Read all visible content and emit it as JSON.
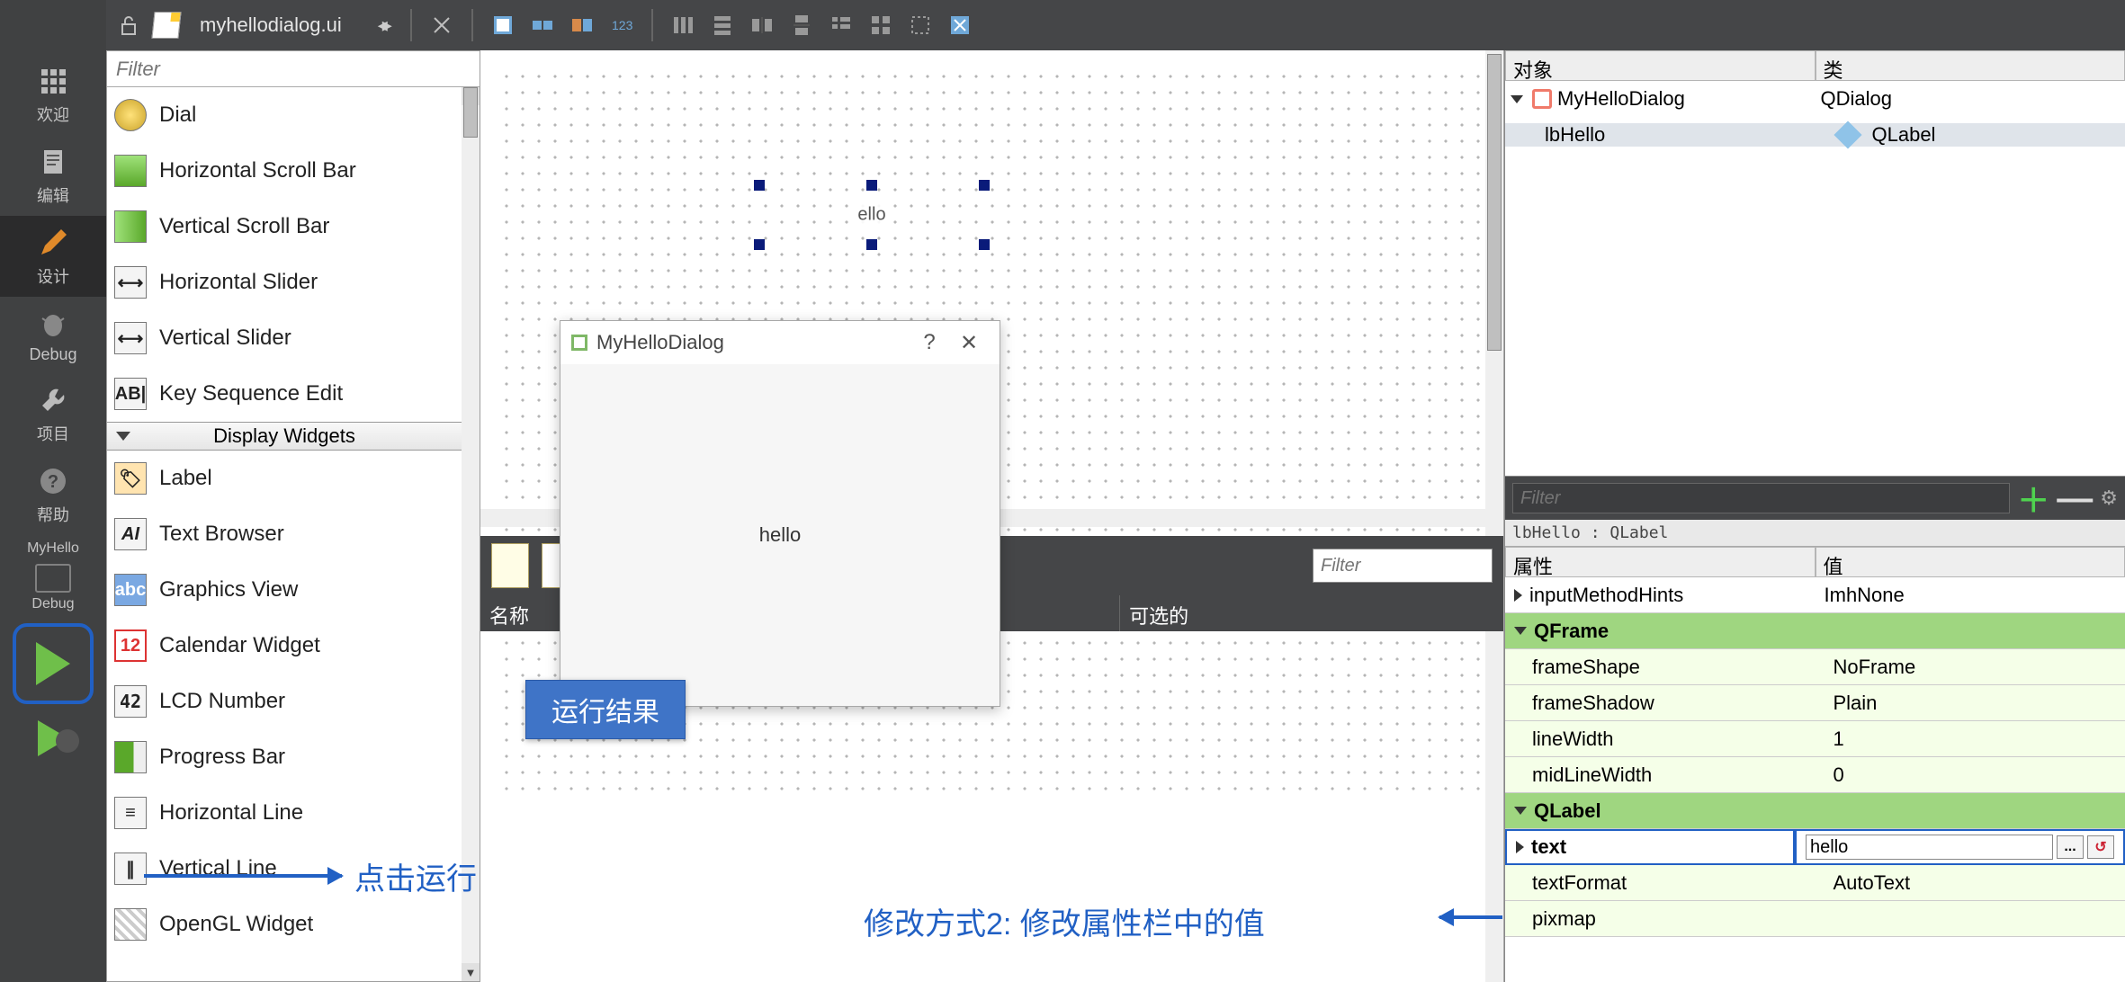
{
  "leftnav": {
    "welcome": "欢迎",
    "edit": "编辑",
    "design": "设计",
    "debug": "Debug",
    "project": "项目",
    "help": "帮助",
    "active_project": "MyHello",
    "kit": "Debug"
  },
  "toolbar": {
    "filename": "myhellodialog.ui"
  },
  "widgetbox": {
    "filter_placeholder": "Filter",
    "group_display": "Display Widgets",
    "items_top": [
      "Dial",
      "Horizontal Scroll Bar",
      "Vertical Scroll Bar",
      "Horizontal Slider",
      "Vertical Slider",
      "Key Sequence Edit"
    ],
    "items_display": [
      "Label",
      "Text Browser",
      "Graphics View",
      "Calendar Widget",
      "LCD Number",
      "Progress Bar",
      "Horizontal Line",
      "Vertical Line",
      "OpenGL Widget"
    ]
  },
  "canvas": {
    "selected_text": "ello"
  },
  "run_dialog": {
    "title": "MyHelloDialog",
    "body": "hello"
  },
  "resources": {
    "filter_placeholder": "Filter",
    "col_name": "名称",
    "col_optional": "可选的"
  },
  "object_tree": {
    "col_object": "对象",
    "col_class": "类",
    "rows": [
      {
        "name": "MyHelloDialog",
        "cls": "QDialog"
      },
      {
        "name": "lbHello",
        "cls": "QLabel"
      }
    ]
  },
  "properties": {
    "filter_placeholder": "Filter",
    "context": "lbHello : QLabel",
    "col_prop": "属性",
    "col_val": "值",
    "rows": [
      {
        "k": "inputMethodHints",
        "v": "ImhNone",
        "type": "plain",
        "expand": true
      },
      {
        "k": "QFrame",
        "type": "group"
      },
      {
        "k": "frameShape",
        "v": "NoFrame",
        "type": "pale"
      },
      {
        "k": "frameShadow",
        "v": "Plain",
        "type": "pale"
      },
      {
        "k": "lineWidth",
        "v": "1",
        "type": "pale"
      },
      {
        "k": "midLineWidth",
        "v": "0",
        "type": "pale"
      },
      {
        "k": "QLabel",
        "type": "group"
      },
      {
        "k": "text",
        "v": "hello",
        "type": "selected"
      },
      {
        "k": "textFormat",
        "v": "AutoText",
        "type": "pale"
      },
      {
        "k": "pixmap",
        "v": "",
        "type": "pale"
      }
    ]
  },
  "annotations": {
    "run_result": "运行结果",
    "click_run": "点击运行",
    "modify_way2": "修改方式2: 修改属性栏中的值"
  }
}
